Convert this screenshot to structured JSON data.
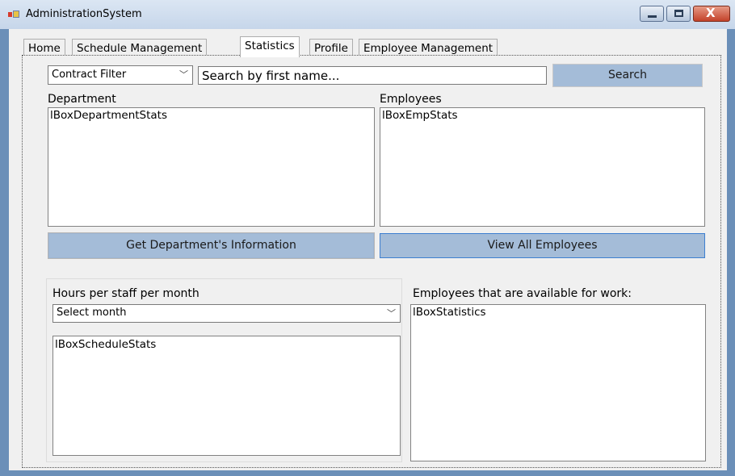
{
  "window": {
    "title": "AdministrationSystem",
    "icon": "app-window-icon",
    "controls": {
      "minimize": "minimize-icon",
      "maximize": "maximize-icon",
      "close": "close-icon",
      "close_glyph": "X"
    }
  },
  "tabs": [
    {
      "label": "Home"
    },
    {
      "label": "Schedule Management"
    },
    {
      "label": "Statistics",
      "active": true
    },
    {
      "label": "Profile"
    },
    {
      "label": "Employee Management"
    }
  ],
  "toolbar": {
    "filter": {
      "selected": "Contract Filter",
      "arrow": "﹀"
    },
    "search": {
      "placeholder": "Search by first name..."
    },
    "search_button": "Search"
  },
  "department": {
    "label": "Department",
    "list_items": [
      "lBoxDepartmentStats"
    ],
    "button": "Get Department's Information"
  },
  "employees": {
    "label": "Employees",
    "list_items": [
      "lBoxEmpStats"
    ],
    "button": "View All Employees"
  },
  "hours": {
    "label": "Hours per staff per month",
    "month_select": {
      "selected": "Select month",
      "arrow": "﹀"
    },
    "list_items": [
      "lBoxScheduleStats"
    ]
  },
  "available": {
    "label": "Employees that are available for work:",
    "list_items": [
      "lBoxStatistics"
    ]
  },
  "colors": {
    "frame": "#6b8fb8",
    "button": "#a4bcd8",
    "focus": "#3d7fd0"
  }
}
